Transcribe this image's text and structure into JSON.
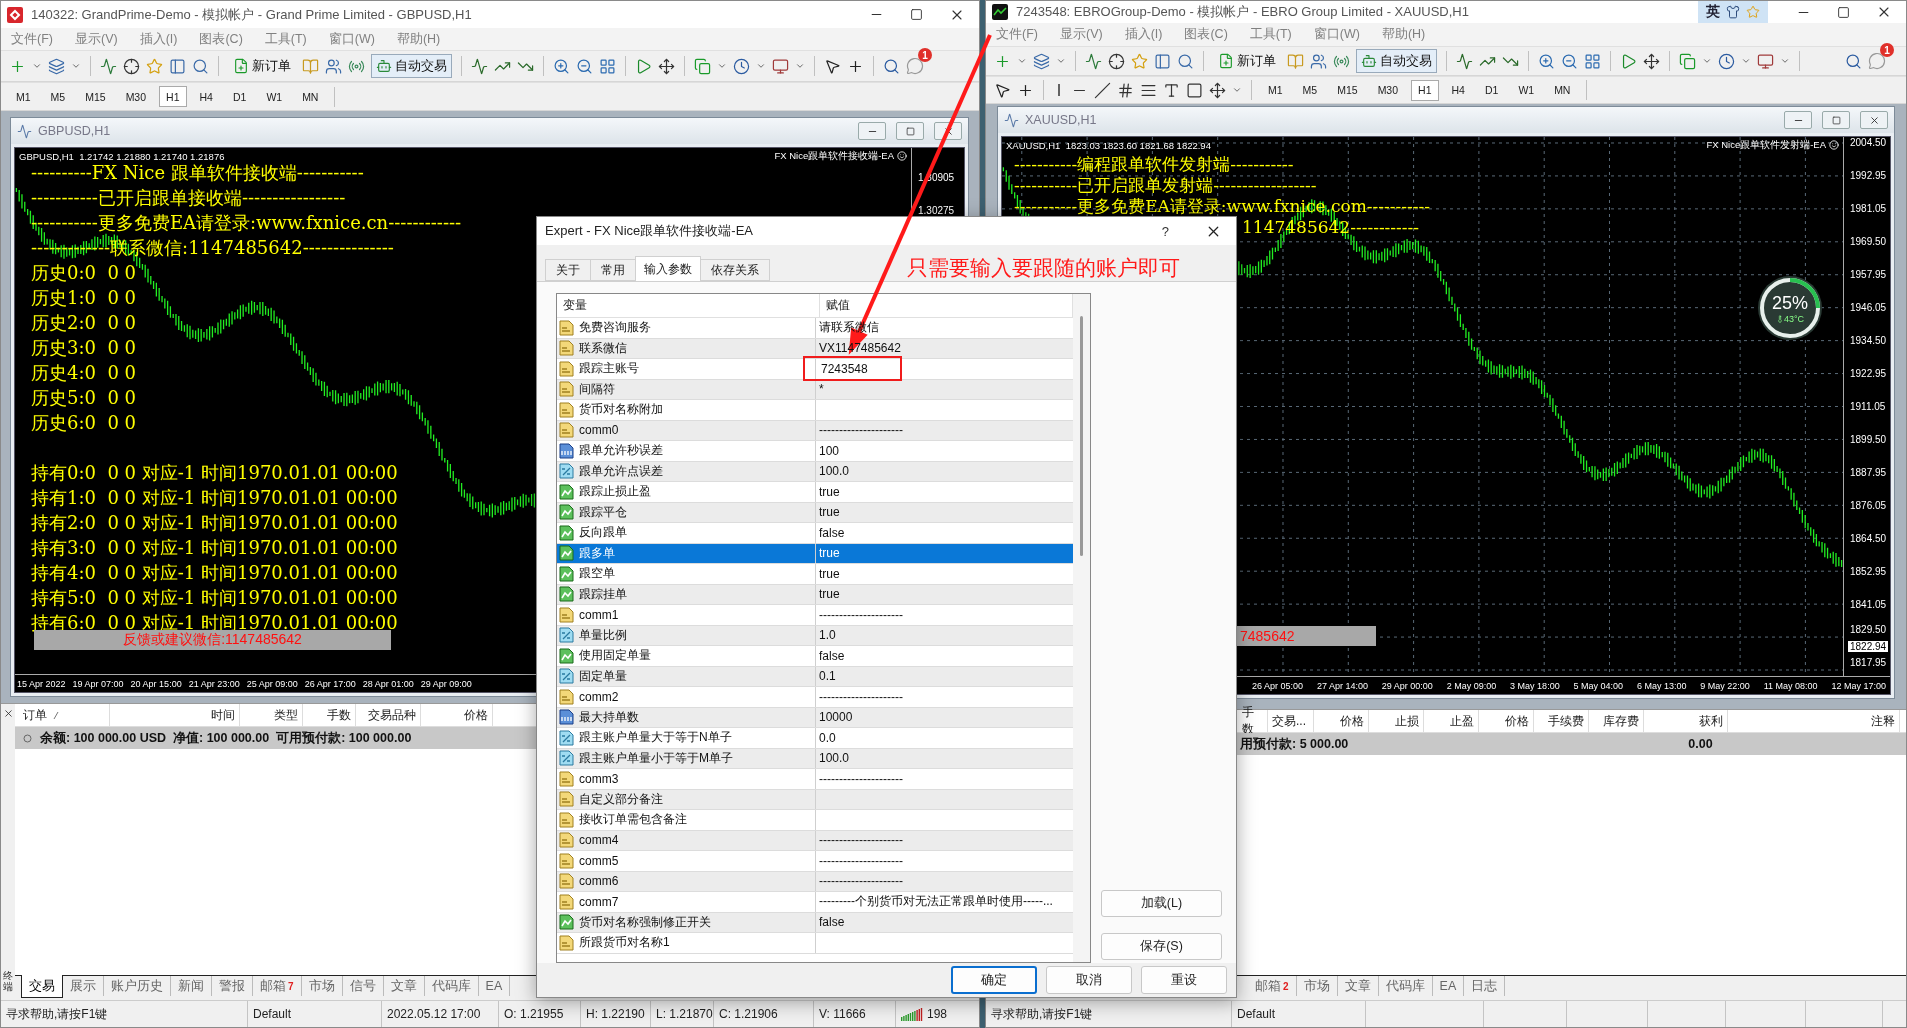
{
  "left_window": {
    "title": "140322: GrandPrime-Demo - 模拟帐户 - Grand Prime Limited - GBPUSD,H1",
    "menu": [
      "文件(F)",
      "显示(V)",
      "插入(I)",
      "图表(C)",
      "工具(T)",
      "窗口(W)",
      "帮助(H)"
    ],
    "toolbar": {
      "new_order": "新订单",
      "auto_trading": "自动交易",
      "notifications": "1"
    },
    "timeframes": [
      {
        "label": "M1",
        "selected": false
      },
      {
        "label": "M5",
        "selected": false
      },
      {
        "label": "M15",
        "selected": false
      },
      {
        "label": "M30",
        "selected": false
      },
      {
        "label": "H1",
        "selected": true
      },
      {
        "label": "H4",
        "selected": false
      },
      {
        "label": "D1",
        "selected": false
      },
      {
        "label": "W1",
        "selected": false
      },
      {
        "label": "MN",
        "selected": false
      }
    ],
    "chart_window": {
      "title": "GBPUSD,H1",
      "header": "GBPUSD,H1  1.21742 1.21880 1.21740 1.21876",
      "ea_label": "FX Nice跟单软件接收端-EA",
      "banner_lines": [
        "----------FX Nice 跟单软件接收端-----------",
        "-----------已开启跟单接收端-----------------",
        "-----------更多免费EA请登录:www.fxnice.cn------------",
        "-------------联系微信:1147485642---------------"
      ],
      "history_lines": [
        "历史0:0  0 0",
        "历史1:0  0 0",
        "历史2:0  0 0",
        "历史3:0  0 0",
        "历史4:0  0 0",
        "历史5:0  0 0",
        "历史6:0  0 0"
      ],
      "position_lines": [
        "持有0:0  0 0 对应-1 时间1970.01.01 00:00",
        "持有1:0  0 0 对应-1 时间1970.01.01 00:00",
        "持有2:0  0 0 对应-1 时间1970.01.01 00:00",
        "持有3:0  0 0 对应-1 时间1970.01.01 00:00",
        "持有4:0  0 0 对应-1 时间1970.01.01 00:00",
        "持有5:0  0 0 对应-1 时间1970.01.01 00:00",
        "持有6:0  0 0 对应-1 时间1970.01.01 00:00"
      ],
      "feedback": "反馈或建议微信:1147485642",
      "price_labels": [
        "1.30905",
        "1.30275"
      ],
      "time_labels": [
        "15 Apr 2022",
        "19 Apr 07:00",
        "20 Apr 15:00",
        "21 Apr 23:00",
        "25 Apr 09:00",
        "26 Apr 17:00",
        "28 Apr 01:00",
        "29 Apr 09:00"
      ]
    },
    "terminal": {
      "side_label": "终端",
      "columns": [
        "订单",
        "时间",
        "类型",
        "手数",
        "交易品种",
        "价格"
      ],
      "balance": "余额: 100 000.00 USD  净值: 100 000.00  可用预付款: 100 000.00",
      "tabs": [
        {
          "label": "交易",
          "selected": true
        },
        {
          "label": "展示",
          "selected": false
        },
        {
          "label": "账户历史",
          "selected": false
        },
        {
          "label": "新闻",
          "selected": false
        },
        {
          "label": "警报",
          "selected": false
        },
        {
          "label": "邮箱",
          "badge": "7",
          "selected": false
        },
        {
          "label": "市场",
          "selected": false
        },
        {
          "label": "信号",
          "selected": false
        },
        {
          "label": "文章",
          "selected": false
        },
        {
          "label": "代码库",
          "selected": false
        },
        {
          "label": "EA",
          "selected": false
        }
      ]
    },
    "status_bar": [
      {
        "kind": "text",
        "text": "寻求帮助,请按F1键"
      },
      {
        "kind": "text",
        "text": "Default"
      },
      {
        "kind": "text",
        "text": "2022.05.12 17:00"
      },
      {
        "kind": "text",
        "text": "O: 1.21955"
      },
      {
        "kind": "text",
        "text": "H: 1.22190"
      },
      {
        "kind": "text",
        "text": "L: 1.21870"
      },
      {
        "kind": "text",
        "text": "C: 1.21906"
      },
      {
        "kind": "text",
        "text": "V: 11666"
      },
      {
        "kind": "traffic",
        "text": "198"
      }
    ]
  },
  "right_window": {
    "title": "7243548: EBROGroup-Demo - 模拟帐户 - EBRO Group Limited - XAUUSD,H1",
    "ime_indicator": "英",
    "menu": [
      "文件(F)",
      "显示(V)",
      "插入(I)",
      "图表(C)",
      "工具(T)",
      "窗口(W)",
      "帮助(H)"
    ],
    "toolbar": {
      "new_order": "新订单",
      "auto_trading": "自动交易",
      "notifications": "1"
    },
    "timeframes": [
      {
        "label": "M1",
        "selected": false
      },
      {
        "label": "M5",
        "selected": false
      },
      {
        "label": "M15",
        "selected": false
      },
      {
        "label": "M30",
        "selected": false
      },
      {
        "label": "H1",
        "selected": true
      },
      {
        "label": "H4",
        "selected": false
      },
      {
        "label": "D1",
        "selected": false
      },
      {
        "label": "W1",
        "selected": false
      },
      {
        "label": "MN",
        "selected": false
      }
    ],
    "chart_window": {
      "title": "XAUUSD,H1",
      "header": "XAUUSD,H1  1823.03 1823.60 1821.68 1822.94",
      "ea_label": "FX Nice跟单软件发射端-EA",
      "banner_lines": [
        "-----------编程跟单软件发射端-----------",
        "-----------已开启跟单发射端------------------",
        "-----------更多免费EA请登录:www.fxnice.com-----------",
        "1147485642------------"
      ],
      "feedback": "7485642",
      "gauge": {
        "percent": "25%",
        "temperature": "43°C"
      },
      "price_labels": [
        "2004.50",
        "1992.95",
        "1981.05",
        "1969.50",
        "1957.95",
        "1946.05",
        "1934.50",
        "1922.95",
        "1911.05",
        "1899.50",
        "1887.95",
        "1876.05",
        "1864.50",
        "1852.95",
        "1841.05",
        "1829.50"
      ],
      "current_price": "1822.94",
      "bottom_price": "1817.95",
      "time_labels": [
        "26 Apr 05:00",
        "27 Apr 14:00",
        "29 Apr 00:00",
        "2 May 09:00",
        "3 May 18:00",
        "5 May 04:00",
        "6 May 13:00",
        "9 May 22:00",
        "11 May 08:00",
        "12 May 17:00"
      ]
    },
    "terminal": {
      "columns": [
        "手数",
        "交易...",
        "价格",
        "止损",
        "止盈",
        "价格",
        "手续费",
        "库存费",
        "获利",
        "注释"
      ],
      "balance": "用预付款: 5 000.00",
      "profit": "0.00",
      "tabs": [
        {
          "label": "邮箱",
          "badge": "2",
          "selected": false
        },
        {
          "label": "市场",
          "selected": false
        },
        {
          "label": "文章",
          "selected": false
        },
        {
          "label": "代码库",
          "selected": false
        },
        {
          "label": "EA",
          "selected": false
        },
        {
          "label": "日志",
          "selected": false
        }
      ]
    },
    "status_bar": [
      "寻求帮助,请按F1键",
      "Default"
    ]
  },
  "dialog": {
    "title": "Expert - FX Nice跟单软件接收端-EA",
    "help": "?",
    "tabs": [
      {
        "label": "关于",
        "selected": false
      },
      {
        "label": "常用",
        "selected": false
      },
      {
        "label": "输入参数",
        "selected": true
      },
      {
        "label": "依存关系",
        "selected": false
      }
    ],
    "annotation": "只需要输入要跟随的账户即可",
    "columns": [
      "变量",
      "赋值"
    ],
    "rows": [
      {
        "kind": "string",
        "name": "免费咨询服务",
        "value": "请联系微信",
        "selected": false,
        "highlighted": false
      },
      {
        "kind": "string",
        "name": "联系微信",
        "value": "VX1147485642",
        "selected": false,
        "highlighted": false
      },
      {
        "kind": "string",
        "name": "跟踪主账号",
        "value": "7243548",
        "selected": false,
        "highlighted": true
      },
      {
        "kind": "string",
        "name": "间隔符",
        "value": "*",
        "selected": false,
        "highlighted": false
      },
      {
        "kind": "string",
        "name": "货币对名称附加",
        "selected": false,
        "highlighted": false
      },
      {
        "kind": "string",
        "name": "comm0",
        "value": "---------------------",
        "selected": false,
        "highlighted": false
      },
      {
        "kind": "int",
        "name": "跟单允许秒误差",
        "value": "100",
        "selected": false,
        "highlighted": false
      },
      {
        "kind": "double",
        "name": "跟单允许点误差",
        "value": "100.0",
        "selected": false,
        "highlighted": false
      },
      {
        "kind": "bool",
        "name": "跟踪止损止盈",
        "value": "true",
        "selected": false,
        "highlighted": false
      },
      {
        "kind": "bool",
        "name": "跟踪平仓",
        "value": "true",
        "selected": false,
        "highlighted": false
      },
      {
        "kind": "bool",
        "name": "反向跟单",
        "value": "false",
        "selected": false,
        "highlighted": false
      },
      {
        "kind": "bool",
        "name": "跟多单",
        "value": "true",
        "selected": true,
        "highlighted": false
      },
      {
        "kind": "bool",
        "name": "跟空单",
        "value": "true",
        "selected": false,
        "highlighted": false
      },
      {
        "kind": "bool",
        "name": "跟踪挂单",
        "value": "true",
        "selected": false,
        "highlighted": false
      },
      {
        "kind": "string",
        "name": "comm1",
        "value": "---------------------",
        "selected": false,
        "highlighted": false
      },
      {
        "kind": "double",
        "name": "单量比例",
        "value": "1.0",
        "selected": false,
        "highlighted": false
      },
      {
        "kind": "bool",
        "name": "使用固定单量",
        "value": "false",
        "selected": false,
        "highlighted": false
      },
      {
        "kind": "double",
        "name": "固定单量",
        "value": "0.1",
        "selected": false,
        "highlighted": false
      },
      {
        "kind": "string",
        "name": "comm2",
        "value": "---------------------",
        "selected": false,
        "highlighted": false
      },
      {
        "kind": "int",
        "name": "最大持单数",
        "value": "10000",
        "selected": false,
        "highlighted": false
      },
      {
        "kind": "double",
        "name": "跟主账户单量大于等于N单子",
        "value": "0.0",
        "selected": false,
        "highlighted": false
      },
      {
        "kind": "double",
        "name": "跟主账户单量小于等于M单子",
        "value": "100.0",
        "selected": false,
        "highlighted": false
      },
      {
        "kind": "string",
        "name": "comm3",
        "value": "---------------------",
        "selected": false,
        "highlighted": false
      },
      {
        "kind": "string",
        "name": "自定义部分备注",
        "selected": false,
        "highlighted": false
      },
      {
        "kind": "string",
        "name": "接收订单需包含备注",
        "selected": false,
        "highlighted": false
      },
      {
        "kind": "string",
        "name": "comm4",
        "value": "---------------------",
        "selected": false,
        "highlighted": false
      },
      {
        "kind": "string",
        "name": "comm5",
        "value": "---------------------",
        "selected": false,
        "highlighted": false
      },
      {
        "kind": "string",
        "name": "comm6",
        "value": "---------------------",
        "selected": false,
        "highlighted": false
      },
      {
        "kind": "string",
        "name": "comm7",
        "value": "---------个别货币对无法正常跟单时使用-----...",
        "selected": false,
        "highlighted": false
      },
      {
        "kind": "bool",
        "name": "货币对名称强制修正开关",
        "value": "false",
        "selected": false,
        "highlighted": false
      },
      {
        "kind": "string",
        "name": "所跟货币对名称1",
        "selected": false,
        "highlighted": false
      }
    ],
    "side_buttons": [
      "加载(L)",
      "保存(S)"
    ],
    "buttons": [
      {
        "label": "确定",
        "focused": true
      },
      {
        "label": "取消",
        "focused": false
      },
      {
        "label": "重设",
        "focused": false
      }
    ]
  }
}
